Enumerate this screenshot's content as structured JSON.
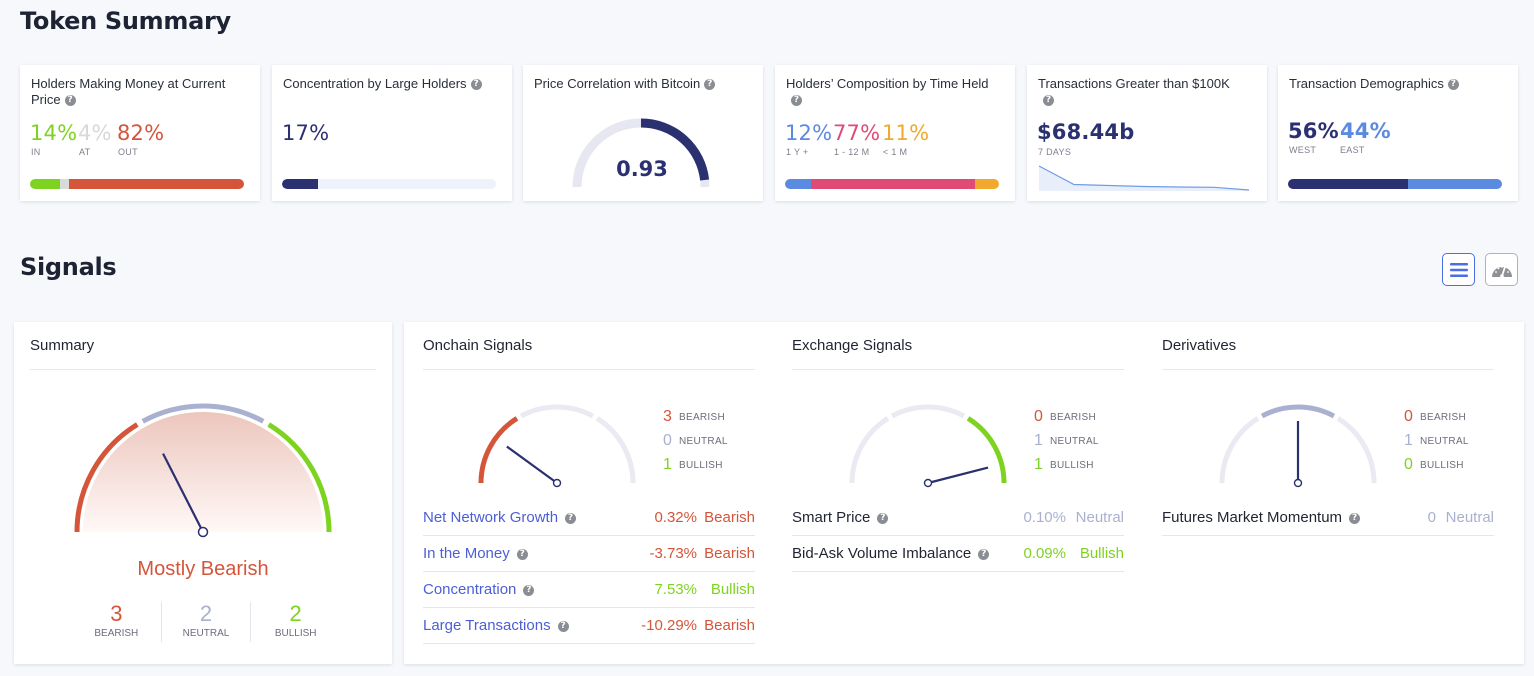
{
  "token_summary": {
    "title": "Token Summary",
    "cards": {
      "holders_money": {
        "title": "Holders Making Money at Current Price",
        "values": [
          {
            "value": "14%",
            "label": "IN",
            "fraction": 0.14,
            "color": "#7ed321"
          },
          {
            "value": "4%",
            "label": "AT",
            "fraction": 0.04,
            "color": "#dadada"
          },
          {
            "value": "82%",
            "label": "OUT",
            "fraction": 0.82,
            "color": "#d4553a"
          }
        ]
      },
      "concentration": {
        "title": "Concentration by Large Holders",
        "value": "17%",
        "fraction": 0.17,
        "color": "#2b3070",
        "track_color": "#eef2fa"
      },
      "correlation": {
        "title": "Price Correlation with Bitcoin",
        "value": "0.93",
        "fraction": 0.93,
        "color": "#2b3070",
        "track_color": "#e6e7f0"
      },
      "composition": {
        "title": "Holders’ Composition by Time Held",
        "values": [
          {
            "value": "12%",
            "label": "1 Y +",
            "fraction": 0.12,
            "color": "#5b8be0"
          },
          {
            "value": "77%",
            "label": "1 - 12 M",
            "fraction": 0.77,
            "color": "#e14a75"
          },
          {
            "value": "11%",
            "label": "< 1 M",
            "fraction": 0.11,
            "color": "#f0a92e"
          }
        ]
      },
      "large_tx": {
        "title": "Transactions Greater than $100K",
        "value": "$68.44b",
        "label": "7 DAYS",
        "sparkline": [
          100,
          26,
          22,
          18,
          16,
          15,
          4
        ]
      },
      "demographics": {
        "title": "Transaction Demographics",
        "values": [
          {
            "value": "56%",
            "label": "WEST",
            "fraction": 0.56,
            "color": "#2b3070"
          },
          {
            "value": "44%",
            "label": "EAST",
            "fraction": 0.44,
            "color": "#5b8be0"
          }
        ]
      }
    }
  },
  "signals": {
    "title": "Signals",
    "toolbar": {
      "list_view_icon": "list-icon",
      "gauge_view_icon": "speedometer-icon"
    },
    "colors": {
      "bearish": "#d4553a",
      "neutral": "#aab0d0",
      "bullish": "#7ed321",
      "needle": "#2b3070",
      "link": "#4c5fd5"
    },
    "summary": {
      "title": "Summary",
      "verdict": "Mostly Bearish",
      "gauge_position": 0.35,
      "counts": [
        {
          "value": "3",
          "label": "BEARISH",
          "kind": "bearish"
        },
        {
          "value": "2",
          "label": "NEUTRAL",
          "kind": "neutral"
        },
        {
          "value": "2",
          "label": "BULLISH",
          "kind": "bullish"
        }
      ]
    },
    "onchain": {
      "title": "Onchain Signals",
      "gauge_position": 0.2,
      "active_segment": "bearish",
      "legend": [
        {
          "value": "3",
          "label": "BEARISH",
          "kind": "bearish"
        },
        {
          "value": "0",
          "label": "NEUTRAL",
          "kind": "neutral"
        },
        {
          "value": "1",
          "label": "BULLISH",
          "kind": "bullish"
        }
      ],
      "rows": [
        {
          "label": "Net Network Growth",
          "value": "0.32%",
          "status": "Bearish",
          "kind": "bearish"
        },
        {
          "label": "In the Money",
          "value": "-3.73%",
          "status": "Bearish",
          "kind": "bearish"
        },
        {
          "label": "Concentration",
          "value": "7.53%",
          "status": "Bullish",
          "kind": "bullish"
        },
        {
          "label": "Large Transactions",
          "value": "-10.29%",
          "status": "Bearish",
          "kind": "bearish"
        }
      ]
    },
    "exchange": {
      "title": "Exchange Signals",
      "gauge_position": 0.92,
      "active_segment": "bullish",
      "legend": [
        {
          "value": "0",
          "label": "BEARISH",
          "kind": "bearish"
        },
        {
          "value": "1",
          "label": "NEUTRAL",
          "kind": "neutral"
        },
        {
          "value": "1",
          "label": "BULLISH",
          "kind": "bullish"
        }
      ],
      "rows": [
        {
          "label": "Smart Price",
          "value": "0.10%",
          "status": "Neutral",
          "kind": "neutral"
        },
        {
          "label": "Bid-Ask Volume Imbalance",
          "value": "0.09%",
          "status": "Bullish",
          "kind": "bullish"
        }
      ]
    },
    "derivatives": {
      "title": "Derivatives",
      "gauge_position": 0.5,
      "active_segment": "neutral",
      "legend": [
        {
          "value": "0",
          "label": "BEARISH",
          "kind": "bearish"
        },
        {
          "value": "1",
          "label": "NEUTRAL",
          "kind": "neutral"
        },
        {
          "value": "0",
          "label": "BULLISH",
          "kind": "bullish"
        }
      ],
      "rows": [
        {
          "label": "Futures Market Momentum",
          "value": "0",
          "status": "Neutral",
          "kind": "neutral"
        }
      ]
    }
  }
}
